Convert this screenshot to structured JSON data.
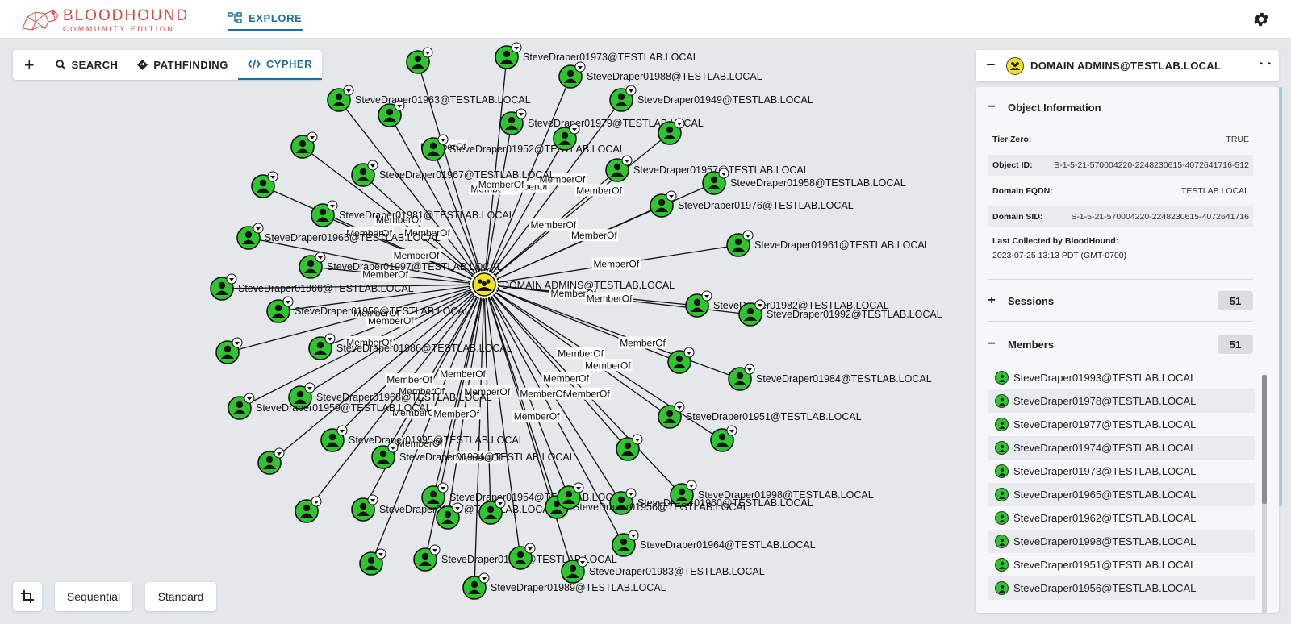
{
  "brand": {
    "name": "BLOODHOUND",
    "edition": "COMMUNITY EDITION",
    "accent": "#d64a44"
  },
  "nav": {
    "explore_label": "EXPLORE",
    "active_color": "#1d6fa3"
  },
  "toolbar": {
    "search": "SEARCH",
    "pathfinding": "PATHFINDING",
    "cypher": "CYPHER"
  },
  "bottom": {
    "sequential": "Sequential",
    "standard": "Standard"
  },
  "graph": {
    "center_label": "DOMAIN ADMINS@TESTLAB.LOCAL",
    "edge_label": "MemberOf",
    "node_color": "#2ec52e",
    "center_color": "#f2e21b",
    "nodes": [
      {
        "label": "SteveDraper01973@TESTLAB.LOCAL",
        "show": true
      },
      {
        "label": "SteveDraper01988@TESTLAB.LOCAL",
        "show": true
      },
      {
        "label": "SteveDraper01963@TESTLAB.LOCAL",
        "show": true
      },
      {
        "label": "SteveDraper01949@TESTLAB.LOCAL",
        "show": true
      },
      {
        "label": "SteveDraper01979@TESTLAB.LOCAL",
        "show": true
      },
      {
        "label": "SteveDraper01952@TESTLAB.LOCAL",
        "show": true
      },
      {
        "label": "SteveDraper01967@TESTLAB.LOCAL",
        "show": true
      },
      {
        "label": "SteveDraper01957@TESTLAB.LOCAL",
        "show": true
      },
      {
        "label": "SteveDraper01958@TESTLAB.LOCAL",
        "show": true
      },
      {
        "label": "SteveDraper01976@TESTLAB.LOCAL",
        "show": true
      },
      {
        "label": "SteveDraper01981@TESTLAB.LOCAL",
        "show": true
      },
      {
        "label": "SteveDraper01965@TESTLAB.LOCAL",
        "show": true
      },
      {
        "label": "SteveDraper01961@TESTLAB.LOCAL",
        "show": true
      },
      {
        "label": "SteveDraper01997@TESTLAB.LOCAL",
        "show": true
      },
      {
        "label": "SteveDraper01966@TESTLAB.LOCAL",
        "show": true
      },
      {
        "label": "SteveDraper01982@TESTLAB.LOCAL",
        "show": true
      },
      {
        "label": "SteveDraper01992@TESTLAB.LOCAL",
        "show": true
      },
      {
        "label": "SteveDraper01950@TESTLAB.LOCAL",
        "show": true
      },
      {
        "label": "SteveDraper01986@TESTLAB.LOCAL",
        "show": true
      },
      {
        "label": "SteveDraper01984@TESTLAB.LOCAL",
        "show": true
      },
      {
        "label": "SteveDraper01968@TESTLAB.LOCAL",
        "show": true
      },
      {
        "label": "SteveDraper01959@TESTLAB.LOCAL",
        "show": true
      },
      {
        "label": "SteveDraper01951@TESTLAB.LOCAL",
        "show": true
      },
      {
        "label": "SteveDraper01995@TESTLAB.LOCAL",
        "show": true
      },
      {
        "label": "SteveDraper01994@TESTLAB.LOCAL",
        "show": true
      },
      {
        "label": "SteveDraper01954@TESTLAB.LOCAL",
        "show": true
      },
      {
        "label": "SteveDraper01960@TESTLAB.LOCAL",
        "show": true
      },
      {
        "label": "SteveDraper01998@TESTLAB.LOCAL",
        "show": true
      },
      {
        "label": "SteveDraper01977@TESTLAB.LOCAL",
        "show": true
      },
      {
        "label": "SteveDraper01956@TESTLAB.LOCAL",
        "show": true
      },
      {
        "label": "SteveDraper01964@TESTLAB.LOCAL",
        "show": true
      },
      {
        "label": "SteveDraper01971@TESTLAB.LOCAL",
        "show": true
      },
      {
        "label": "SteveDraper01983@TESTLAB.LOCAL",
        "show": true
      },
      {
        "label": "SteveDraper01989@TESTLAB.LOCAL",
        "show": true
      },
      {
        "label": "",
        "show": false
      },
      {
        "label": "",
        "show": false
      },
      {
        "label": "",
        "show": false
      },
      {
        "label": "",
        "show": false
      },
      {
        "label": "",
        "show": false
      },
      {
        "label": "",
        "show": false
      },
      {
        "label": "",
        "show": false
      },
      {
        "label": "",
        "show": false
      },
      {
        "label": "",
        "show": false
      },
      {
        "label": "",
        "show": false
      },
      {
        "label": "",
        "show": false
      },
      {
        "label": "",
        "show": false
      },
      {
        "label": "",
        "show": false
      },
      {
        "label": "",
        "show": false
      },
      {
        "label": "",
        "show": false
      },
      {
        "label": "",
        "show": false
      },
      {
        "label": "",
        "show": false
      }
    ]
  },
  "panel": {
    "title": "DOMAIN ADMINS@TESTLAB.LOCAL",
    "object_info_label": "Object Information",
    "tier_zero": {
      "key": "Tier Zero:",
      "value": "TRUE"
    },
    "object_id": {
      "key": "Object ID:",
      "value": "S-1-5-21-570004220-2248230615-4072641716-512"
    },
    "domain_fqdn": {
      "key": "Domain FQDN:",
      "value": "TESTLAB.LOCAL"
    },
    "domain_sid": {
      "key": "Domain SID:",
      "value": "S-1-5-21-570004220-2248230615-4072641716"
    },
    "last_collected": {
      "key": "Last Collected by BloodHound:",
      "value": "2023-07-25 13:13 PDT (GMT-0700)"
    },
    "sessions": {
      "label": "Sessions",
      "count": "51"
    },
    "members": {
      "label": "Members",
      "count": "51",
      "items": [
        "SteveDraper01993@TESTLAB.LOCAL",
        "SteveDraper01978@TESTLAB.LOCAL",
        "SteveDraper01977@TESTLAB.LOCAL",
        "SteveDraper01974@TESTLAB.LOCAL",
        "SteveDraper01973@TESTLAB.LOCAL",
        "SteveDraper01965@TESTLAB.LOCAL",
        "SteveDraper01962@TESTLAB.LOCAL",
        "SteveDraper01998@TESTLAB.LOCAL",
        "SteveDraper01951@TESTLAB.LOCAL",
        "SteveDraper01956@TESTLAB.LOCAL"
      ]
    }
  }
}
